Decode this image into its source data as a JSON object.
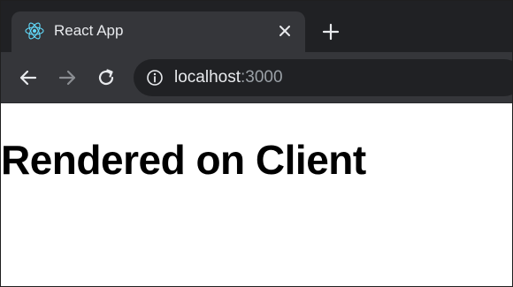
{
  "tab": {
    "title": "React App",
    "favicon_icon": "react-logo-icon",
    "close_icon": "close-icon"
  },
  "new_tab_icon": "plus-icon",
  "toolbar": {
    "back_icon": "arrow-left-icon",
    "forward_icon": "arrow-right-icon",
    "reload_icon": "reload-icon",
    "site_info_icon": "info-icon",
    "url_host": "localhost",
    "url_port": ":3000"
  },
  "page": {
    "heading": "Rendered on Client"
  },
  "colors": {
    "tabstrip_bg": "#202124",
    "tab_bg": "#35363a",
    "omnibox_bg": "#202124",
    "text_primary": "#e8eaed",
    "text_muted": "#9aa0a6",
    "react_blue": "#61dafb"
  }
}
